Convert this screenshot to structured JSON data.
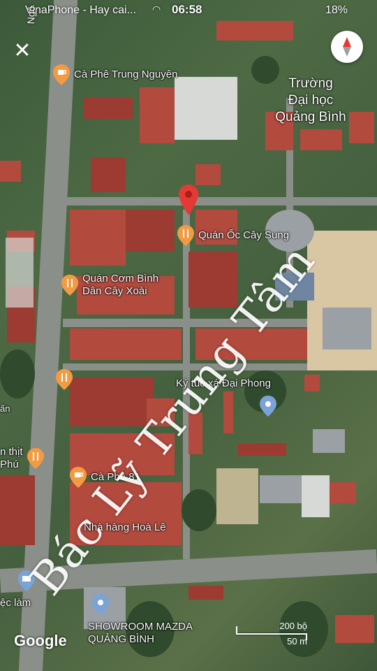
{
  "status_bar": {
    "carrier": "VinaPhone - Hay cai...",
    "time": "06:58",
    "battery": "18%"
  },
  "controls": {
    "close_icon": "close-icon",
    "compass_icon": "compass-icon"
  },
  "places": {
    "university": "Trường\nĐại học\nQuảng Bình",
    "road_partial": "Ngô"
  },
  "pois": [
    {
      "name": "Cà Phê Trung Nguyên",
      "icon": "coffee-icon",
      "color": "#f29b42"
    },
    {
      "name": "Quán Ốc Cây Sung",
      "icon": "restaurant-icon",
      "color": "#f29b42"
    },
    {
      "name": "Quán Cơm Bình\nDân Cây Xoài",
      "icon": "restaurant-icon",
      "color": "#f29b42"
    },
    {
      "name": "",
      "icon": "restaurant-icon",
      "color": "#f29b42"
    },
    {
      "name": "Ký túc xá Đại Phong",
      "icon": "",
      "color": ""
    },
    {
      "name": "",
      "icon": "place-icon",
      "color": "#7aa3d6"
    },
    {
      "name": "n thịt\nPhú",
      "icon": "restaurant-icon",
      "color": "#f29b42"
    },
    {
      "name": "Cà Phê 81",
      "icon": "coffee-icon",
      "color": "#f29b42"
    },
    {
      "name": "Nhà hàng Hoà Lê",
      "icon": "restaurant-icon",
      "color": "#f29b42"
    },
    {
      "name": "ấn",
      "icon": "",
      "color": ""
    },
    {
      "name": "ệc làm",
      "icon": "bank-icon",
      "color": "#7aa3d6"
    },
    {
      "name": "SHOWROOM MAZDA\nQUẢNG BÌNH",
      "icon": "place-icon",
      "color": "#7aa3d6"
    }
  ],
  "selected_pin": {
    "icon": "red-pin-icon",
    "color": "#e53935"
  },
  "watermark": "Bác Lỹ Trung Tâm",
  "attribution": "Google",
  "scale": {
    "top": "200 bộ",
    "bottom": "50 m"
  }
}
